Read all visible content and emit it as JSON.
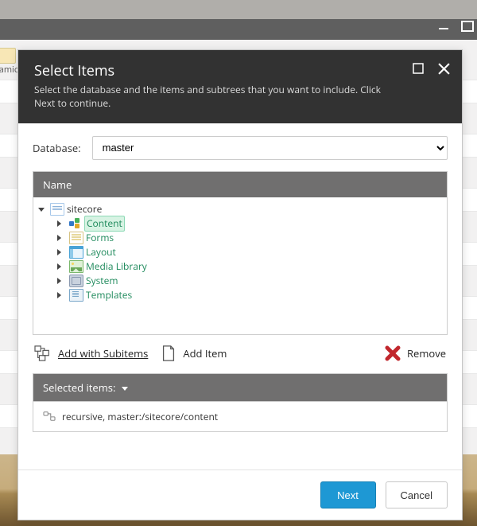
{
  "bg": {
    "thumb_label": "namic"
  },
  "dialog": {
    "title": "Select Items",
    "subtitle": "Select the database and the items and subtrees that you want to include. Click Next to continue.",
    "database_label": "Database:",
    "database_value": "master",
    "tree_header": "Name",
    "root": {
      "label": "sitecore",
      "children": [
        {
          "label": "Content",
          "icon": "ic-cubes",
          "selected": true
        },
        {
          "label": "Forms",
          "icon": "ic-form",
          "selected": false
        },
        {
          "label": "Layout",
          "icon": "ic-layout",
          "selected": false
        },
        {
          "label": "Media Library",
          "icon": "ic-media",
          "selected": false
        },
        {
          "label": "System",
          "icon": "ic-system",
          "selected": false
        },
        {
          "label": "Templates",
          "icon": "ic-templ",
          "selected": false
        }
      ]
    },
    "actions": {
      "add_subitems": "Add with Subitems",
      "add_item": "Add Item",
      "remove": "Remove"
    },
    "selected_header": "Selected items:",
    "selected_items": [
      "recursive, master:/sitecore/content"
    ],
    "buttons": {
      "next": "Next",
      "cancel": "Cancel"
    }
  }
}
